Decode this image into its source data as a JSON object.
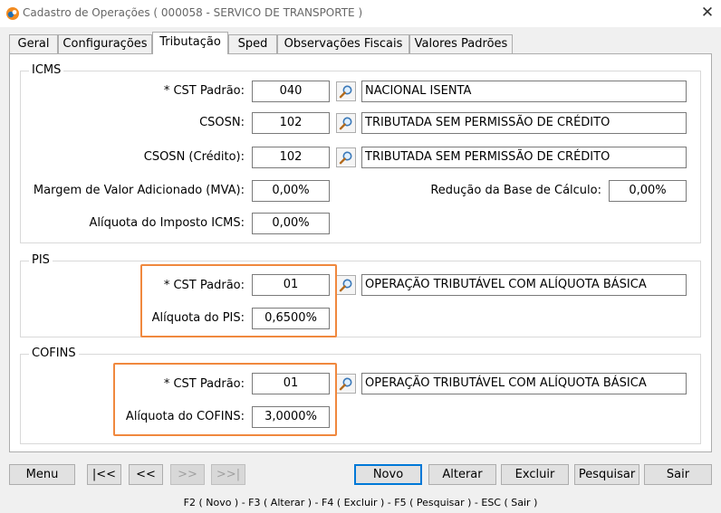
{
  "window": {
    "title": "Cadastro de Operações ( 000058 - SERVICO DE TRANSPORTE )"
  },
  "tabs": [
    {
      "label": "Geral"
    },
    {
      "label": "Configurações"
    },
    {
      "label": "Tributação",
      "active": true
    },
    {
      "label": "Sped"
    },
    {
      "label": "Observações Fiscais"
    },
    {
      "label": "Valores Padrões"
    }
  ],
  "icms": {
    "title": "ICMS",
    "cst_label": "* CST Padrão:",
    "cst_value": "040",
    "cst_desc": "NACIONAL ISENTA",
    "csosn_label": "CSOSN:",
    "csosn_value": "102",
    "csosn_desc": "TRIBUTADA SEM PERMISSÃO DE CRÉDITO",
    "csosn_credito_label": "CSOSN (Crédito):",
    "csosn_credito_value": "102",
    "csosn_credito_desc": "TRIBUTADA SEM PERMISSÃO DE CRÉDITO",
    "mva_label": "Margem de Valor Adicionado (MVA):",
    "mva_value": "0,00%",
    "reducao_label": "Redução da Base de Cálculo:",
    "reducao_value": "0,00%",
    "aliquota_label": "Alíquota do Imposto ICMS:",
    "aliquota_value": "0,00%"
  },
  "pis": {
    "title": "PIS",
    "cst_label": "* CST Padrão:",
    "cst_value": "01",
    "cst_desc": "OPERAÇÃO TRIBUTÁVEL COM ALÍQUOTA BÁSICA",
    "aliquota_label": "Alíquota do PIS:",
    "aliquota_value": "0,6500%"
  },
  "cofins": {
    "title": "COFINS",
    "cst_label": "* CST Padrão:",
    "cst_value": "01",
    "cst_desc": "OPERAÇÃO TRIBUTÁVEL COM ALÍQUOTA BÁSICA",
    "aliquota_label": "Alíquota do COFINS:",
    "aliquota_value": "3,0000%"
  },
  "buttons": {
    "menu": "Menu",
    "first": "|<<",
    "prev": "<<",
    "next": ">>",
    "last": ">>|",
    "novo": "Novo",
    "alterar": "Alterar",
    "excluir": "Excluir",
    "pesquisar": "Pesquisar",
    "sair": "Sair"
  },
  "statusbar": {
    "text": "F2 ( Novo )  -  F3 ( Alterar )  -  F4 ( Excluir )  -  F5 ( Pesquisar )  -  ESC ( Sair )"
  },
  "colors": {
    "highlight": "#f0883e",
    "default_button_border": "#0078d7"
  },
  "icons": {
    "app": "app-logo-icon",
    "close": "close-icon",
    "lookup": "magnifier-icon"
  }
}
